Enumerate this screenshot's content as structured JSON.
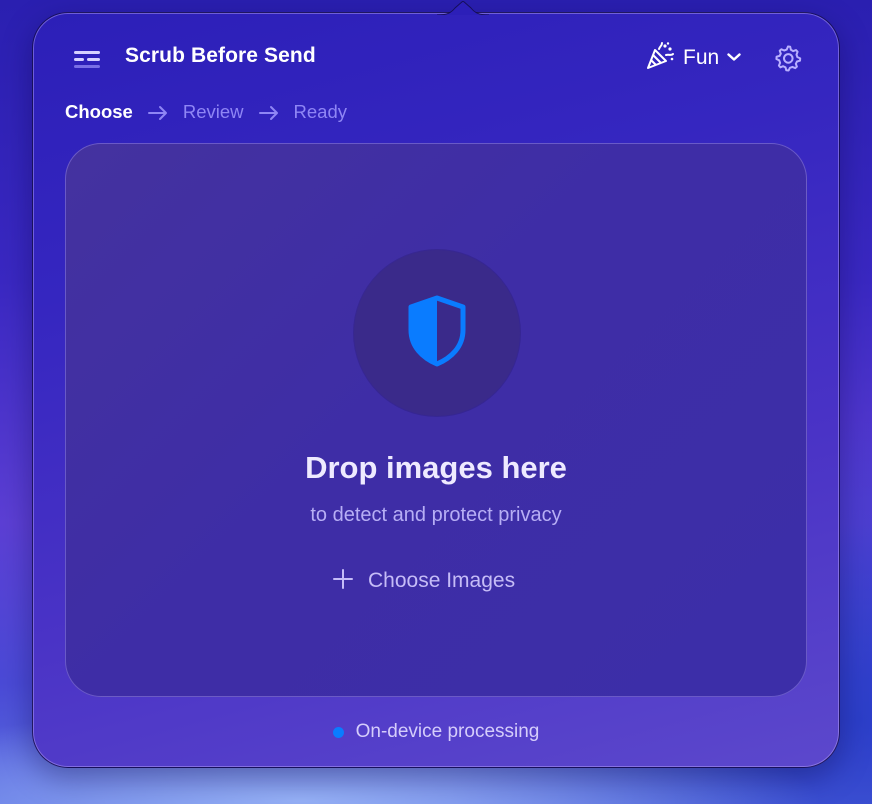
{
  "header": {
    "title": "Scrub Before Send",
    "menu_icon": "sidebar-menu-icon",
    "mode": {
      "label": "Fun",
      "icon": "party-popper-icon",
      "chevron": "chevron-down-icon"
    },
    "settings_icon": "gear-icon"
  },
  "steps": [
    {
      "label": "Choose",
      "state": "active"
    },
    {
      "label": "Review",
      "state": "pending"
    },
    {
      "label": "Ready",
      "state": "pending"
    }
  ],
  "dropzone": {
    "icon": "shield-icon",
    "title": "Drop images here",
    "subtitle": "to detect and protect privacy",
    "button_label": "Choose Images",
    "button_icon": "plus-icon"
  },
  "footer": {
    "status_text": "On-device processing",
    "status_color": "#0a7cff"
  },
  "colors": {
    "accent": "#0a7cff",
    "step_inactive": "#8f86f5"
  }
}
